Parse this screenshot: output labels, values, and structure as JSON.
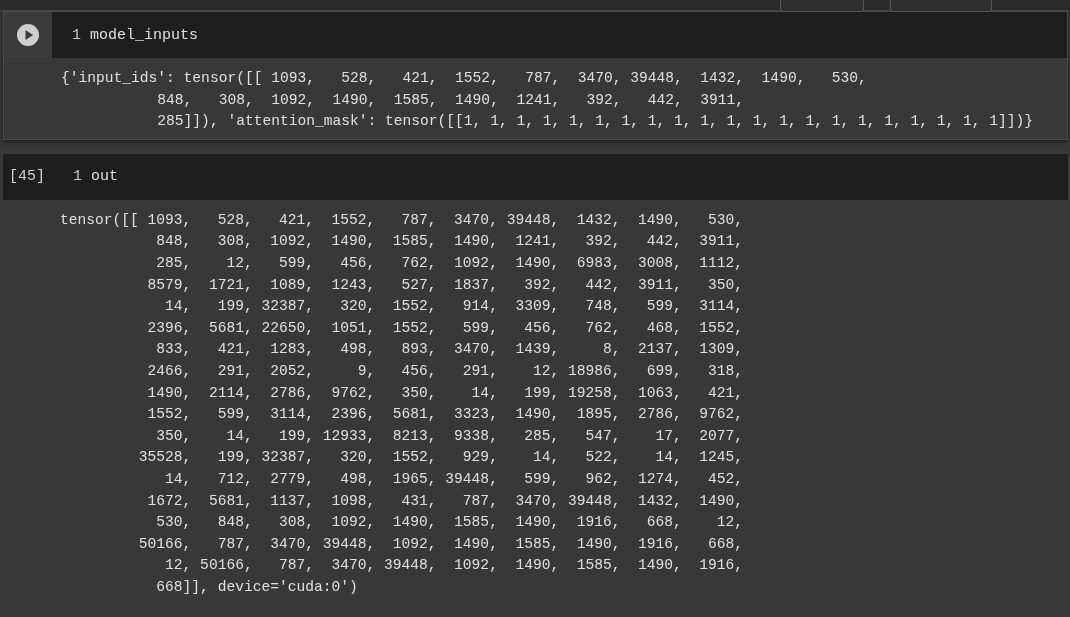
{
  "cells": [
    {
      "focused": true,
      "line_number": "1",
      "code": "model_inputs",
      "output": [
        "{'input_ids': tensor([[ 1093,   528,   421,  1552,   787,  3470, 39448,  1432,  1490,   530,",
        "           848,   308,  1092,  1490,  1585,  1490,  1241,   392,   442,  3911,",
        "           285]]), 'attention_mask': tensor([[1, 1, 1, 1, 1, 1, 1, 1, 1, 1, 1, 1, 1, 1, 1, 1, 1, 1, 1, 1, 1]])}"
      ]
    },
    {
      "focused": false,
      "execution_count": "[45]",
      "line_number": "1",
      "code": "out",
      "output": [
        "tensor([[ 1093,   528,   421,  1552,   787,  3470, 39448,  1432,  1490,   530,",
        "           848,   308,  1092,  1490,  1585,  1490,  1241,   392,   442,  3911,",
        "           285,    12,   599,   456,   762,  1092,  1490,  6983,  3008,  1112,",
        "          8579,  1721,  1089,  1243,   527,  1837,   392,   442,  3911,   350,",
        "            14,   199, 32387,   320,  1552,   914,  3309,   748,   599,  3114,",
        "          2396,  5681, 22650,  1051,  1552,   599,   456,   762,   468,  1552,",
        "           833,   421,  1283,   498,   893,  3470,  1439,     8,  2137,  1309,",
        "          2466,   291,  2052,     9,   456,   291,    12, 18986,   699,   318,",
        "          1490,  2114,  2786,  9762,   350,    14,   199, 19258,  1063,   421,",
        "          1552,   599,  3114,  2396,  5681,  3323,  1490,  1895,  2786,  9762,",
        "           350,    14,   199, 12933,  8213,  9338,   285,   547,    17,  2077,",
        "         35528,   199, 32387,   320,  1552,   929,    14,   522,    14,  1245,",
        "            14,   712,  2779,   498,  1965, 39448,   599,   962,  1274,   452,",
        "          1672,  5681,  1137,  1098,   431,   787,  3470, 39448,  1432,  1490,",
        "           530,   848,   308,  1092,  1490,  1585,  1490,  1916,   668,    12,",
        "         50166,   787,  3470, 39448,  1092,  1490,  1585,  1490,  1916,   668,",
        "            12, 50166,   787,  3470, 39448,  1092,  1490,  1585,  1490,  1916,",
        "           668]], device='cuda:0')"
      ]
    }
  ]
}
